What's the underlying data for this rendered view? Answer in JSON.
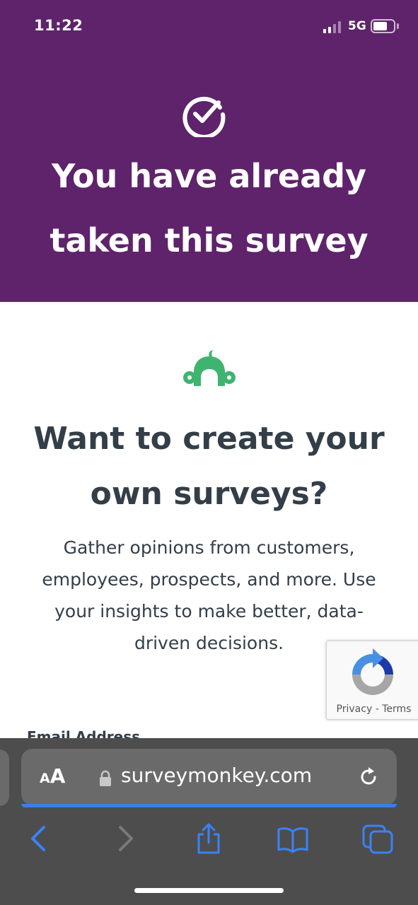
{
  "status_bar": {
    "time": "11:22",
    "network": "5G"
  },
  "header": {
    "title": "You have already taken this survey",
    "background_color": "#5e236b",
    "icon": "check-circle-icon"
  },
  "promo": {
    "logo_icon": "surveymonkey-logo-icon",
    "logo_color": "#3fb46f",
    "title": "Want to create your own surveys?",
    "description": "Gather opinions from customers, employees, prospects, and more. Use your insights to make better, data-driven decisions."
  },
  "form": {
    "email_label": "Email Address"
  },
  "recaptcha": {
    "privacy": "Privacy",
    "separator": " - ",
    "terms": "Terms"
  },
  "browser": {
    "text_size_small": "A",
    "text_size_large": "A",
    "url": "surveymonkey.com",
    "accent_color": "#3b82f6",
    "icons": [
      "back-icon",
      "forward-icon",
      "share-icon",
      "bookmarks-icon",
      "tabs-icon",
      "reload-icon",
      "lock-icon"
    ]
  }
}
